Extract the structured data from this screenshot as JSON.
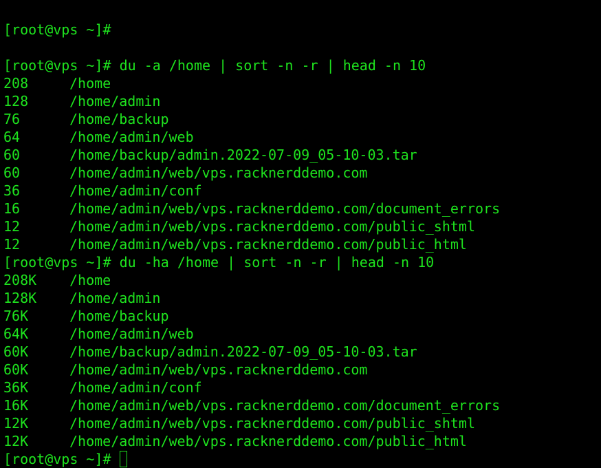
{
  "terminal": {
    "text_color": "#1ee31e",
    "background": "#000000",
    "partial_top_line": "[root@vps ~]#",
    "prompt": "[root@vps ~]#",
    "blocks": [
      {
        "command": "du -a /home | sort -n -r | head -n 10",
        "rows": [
          {
            "size": "208",
            "path": "/home"
          },
          {
            "size": "128",
            "path": "/home/admin"
          },
          {
            "size": "76",
            "path": "/home/backup"
          },
          {
            "size": "64",
            "path": "/home/admin/web"
          },
          {
            "size": "60",
            "path": "/home/backup/admin.2022-07-09_05-10-03.tar"
          },
          {
            "size": "60",
            "path": "/home/admin/web/vps.racknerddemo.com"
          },
          {
            "size": "36",
            "path": "/home/admin/conf"
          },
          {
            "size": "16",
            "path": "/home/admin/web/vps.racknerddemo.com/document_errors"
          },
          {
            "size": "12",
            "path": "/home/admin/web/vps.racknerddemo.com/public_shtml"
          },
          {
            "size": "12",
            "path": "/home/admin/web/vps.racknerddemo.com/public_html"
          }
        ]
      },
      {
        "command": "du -ha /home | sort -n -r | head -n 10",
        "rows": [
          {
            "size": "208K",
            "path": "/home"
          },
          {
            "size": "128K",
            "path": "/home/admin"
          },
          {
            "size": "76K",
            "path": "/home/backup"
          },
          {
            "size": "64K",
            "path": "/home/admin/web"
          },
          {
            "size": "60K",
            "path": "/home/backup/admin.2022-07-09_05-10-03.tar"
          },
          {
            "size": "60K",
            "path": "/home/admin/web/vps.racknerddemo.com"
          },
          {
            "size": "36K",
            "path": "/home/admin/conf"
          },
          {
            "size": "16K",
            "path": "/home/admin/web/vps.racknerddemo.com/document_errors"
          },
          {
            "size": "12K",
            "path": "/home/admin/web/vps.racknerddemo.com/public_shtml"
          },
          {
            "size": "12K",
            "path": "/home/admin/web/vps.racknerddemo.com/public_html"
          }
        ]
      }
    ]
  }
}
